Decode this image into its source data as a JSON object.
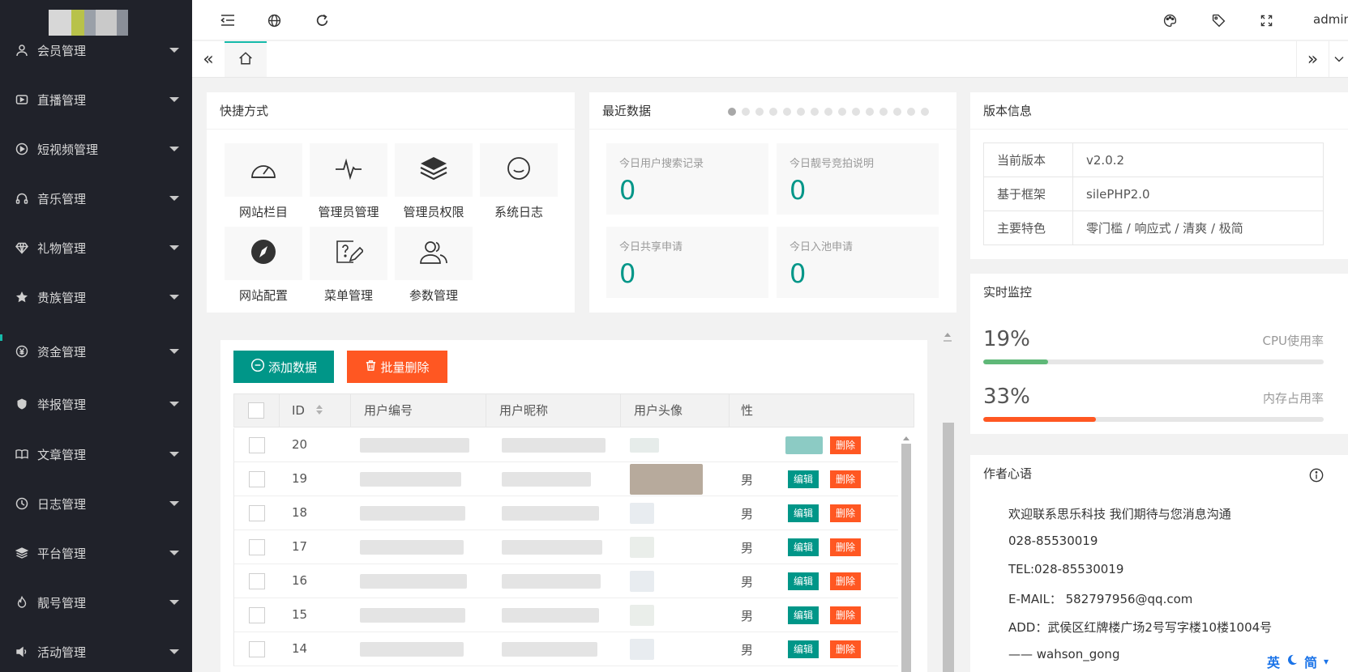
{
  "sidebar": {
    "items": [
      {
        "label": "会员管理",
        "icon": "user-icon"
      },
      {
        "label": "直播管理",
        "icon": "video-icon"
      },
      {
        "label": "短视频管理",
        "icon": "play-icon"
      },
      {
        "label": "音乐管理",
        "icon": "headphones-icon"
      },
      {
        "label": "礼物管理",
        "icon": "diamond-icon"
      },
      {
        "label": "贵族管理",
        "icon": "star-icon"
      },
      {
        "label": "资金管理",
        "icon": "yen-icon"
      },
      {
        "label": "举报管理",
        "icon": "shield-icon"
      },
      {
        "label": "文章管理",
        "icon": "book-icon"
      },
      {
        "label": "日志管理",
        "icon": "clock-icon"
      },
      {
        "label": "平台管理",
        "icon": "layers-icon"
      },
      {
        "label": "靓号管理",
        "icon": "fire-icon"
      },
      {
        "label": "活动管理",
        "icon": "speaker-icon"
      }
    ]
  },
  "header": {
    "user": "admin"
  },
  "shortcuts": {
    "title": "快捷方式",
    "items": [
      {
        "label": "网站栏目",
        "icon": "gauge-icon"
      },
      {
        "label": "管理员管理",
        "icon": "pulse-icon"
      },
      {
        "label": "管理员权限",
        "icon": "stack-icon"
      },
      {
        "label": "系统日志",
        "icon": "smile-icon"
      },
      {
        "label": "网站配置",
        "icon": "compass-icon"
      },
      {
        "label": "菜单管理",
        "icon": "question-edit-icon"
      },
      {
        "label": "参数管理",
        "icon": "users-icon"
      }
    ]
  },
  "recent": {
    "title": "最近数据",
    "stats": [
      {
        "label": "今日用户搜索记录",
        "value": "0"
      },
      {
        "label": "今日靓号竞拍说明",
        "value": "0"
      },
      {
        "label": "今日共享申请",
        "value": "0"
      },
      {
        "label": "今日入池申请",
        "value": "0"
      }
    ]
  },
  "version": {
    "title": "版本信息",
    "rows": [
      {
        "key": "当前版本",
        "value": "v2.0.2"
      },
      {
        "key": "基于框架",
        "value": "silePHP2.0"
      },
      {
        "key": "主要特色",
        "value": "零门槛 / 响应式 / 清爽 / 极简"
      }
    ]
  },
  "monitor": {
    "title": "实时监控",
    "cpu": {
      "value": "19%",
      "percent": 19,
      "label": "CPU使用率",
      "color": "#5FB878"
    },
    "mem": {
      "value": "33%",
      "percent": 33,
      "label": "内存占用率",
      "color": "#FF5722"
    }
  },
  "author": {
    "title": "作者心语",
    "lines": [
      "欢迎联系思乐科技 我们期待与您消息沟通",
      "028-85530019",
      "TEL:028-85530019",
      "E-MAIL： 582797956@qq.com",
      "ADD：武侯区红牌楼广场2号写字楼10楼1004号",
      "—— wahson_gong"
    ]
  },
  "table": {
    "add_label": "添加数据",
    "batch_delete_label": "批量删除",
    "columns": {
      "id": "ID",
      "user_no": "用户编号",
      "nickname": "用户昵称",
      "avatar": "用户头像",
      "sex": "性"
    },
    "edit_label": "编辑",
    "delete_label": "删除",
    "rows": [
      {
        "id": "20",
        "sex": ""
      },
      {
        "id": "19",
        "sex": "男"
      },
      {
        "id": "18",
        "sex": "男"
      },
      {
        "id": "17",
        "sex": "男"
      },
      {
        "id": "16",
        "sex": "男"
      },
      {
        "id": "15",
        "sex": "男"
      },
      {
        "id": "14",
        "sex": "男"
      }
    ]
  },
  "ime": {
    "lang": "英",
    "mode": "简"
  },
  "colors": {
    "sidebar": "#20222a",
    "primary": "#009688",
    "danger": "#FF5722",
    "accent": "#16baaa"
  }
}
